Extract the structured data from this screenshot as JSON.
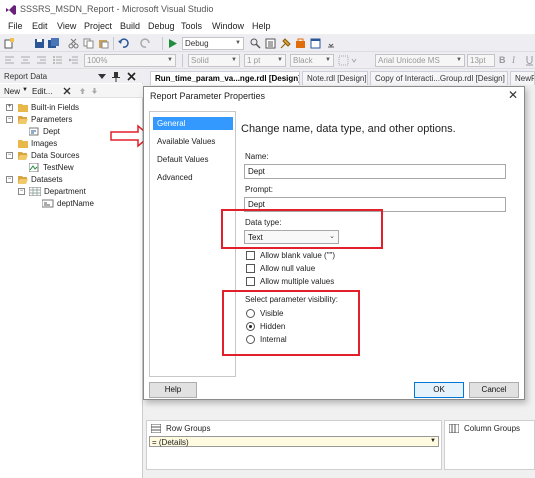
{
  "window": {
    "title": "SSSRS_MSDN_Report - Microsoft Visual Studio"
  },
  "menu": {
    "items": [
      "File",
      "Edit",
      "View",
      "Project",
      "Build",
      "Debug",
      "Tools",
      "Window",
      "Help"
    ]
  },
  "toolbar": {
    "config_value": "Debug",
    "zoom_value": "100%",
    "border_style_value": "Solid",
    "border_width_value": "1 pt",
    "border_color_value": "Black",
    "font_value": "Arial Unicode MS",
    "font_size_value": "13pt",
    "bold_label": "B",
    "italic_label": "I"
  },
  "report_data": {
    "title": "Report Data",
    "new_label": "New",
    "edit_label": "Edit...",
    "tree": {
      "built_in_fields": "Built-in Fields",
      "parameters": "Parameters",
      "dept": "Dept",
      "images": "Images",
      "data_sources": "Data Sources",
      "test_new": "TestNew",
      "datasets": "Datasets",
      "department": "Department",
      "dept_name": "deptName"
    }
  },
  "tabs": [
    {
      "label": "Run_time_param_va...nge.rdl [Design]*"
    },
    {
      "label": "Note.rdl [Design]"
    },
    {
      "label": "Copy of Interacti...Group.rdl [Design]"
    },
    {
      "label": "NewF"
    }
  ],
  "dialog": {
    "title": "Report Parameter Properties",
    "close_glyph": "✕",
    "nav": [
      "General",
      "Available Values",
      "Default Values",
      "Advanced"
    ],
    "heading": "Change name, data type, and other options.",
    "name_label": "Name:",
    "name_value": "Dept",
    "prompt_label": "Prompt:",
    "prompt_value": "Dept",
    "data_type_label": "Data type:",
    "data_type_value": "Text",
    "allow_blank": "Allow blank value (\"\")",
    "allow_null": "Allow null value",
    "allow_multiple": "Allow multiple values",
    "visibility_label": "Select parameter visibility:",
    "visibility_options": [
      "Visible",
      "Hidden",
      "Internal"
    ],
    "visibility_selected": "Hidden",
    "help_label": "Help",
    "ok_label": "OK",
    "cancel_label": "Cancel"
  },
  "groups": {
    "row_groups_label": "Row Groups",
    "column_groups_label": "Column Groups",
    "details_label": "= (Details)"
  },
  "colors": {
    "selection": "#3399ff",
    "annotation_red": "#e2202b",
    "folder": "#e8b84a"
  }
}
